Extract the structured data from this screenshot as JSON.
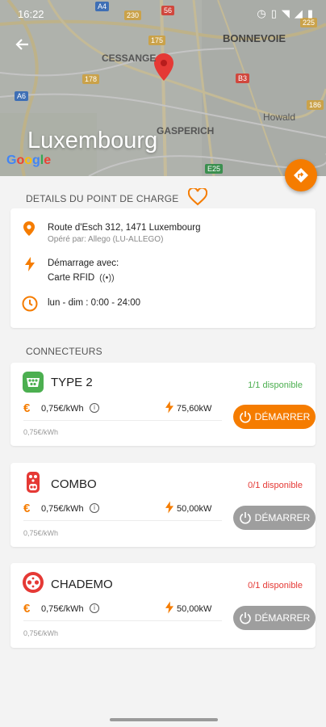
{
  "status_bar": {
    "time": "16:22"
  },
  "map": {
    "title": "Luxembourg",
    "google_logo": "Google",
    "labels": {
      "cessange": "CESSANGE",
      "bonnevoie": "BONNEVOIE",
      "gasperich": "GASPERICH",
      "howald": "Howald"
    },
    "shields": [
      "A4",
      "230",
      "56",
      "175",
      "178",
      "B3",
      "A6",
      "E25",
      "225",
      "186"
    ]
  },
  "details": {
    "section_title": "DETAILS DU POINT DE CHARGE",
    "address": "Route d'Esch 312, 1471 Luxembourg",
    "operator": "Opéré par: Allego (LU-ALLEGO)",
    "start_label": "Démarrage avec:",
    "start_method": "Carte RFID",
    "hours": "lun - dim : 0:00 - 24:00"
  },
  "connectors": {
    "section_title": "CONNECTEURS",
    "items": [
      {
        "name": "TYPE 2",
        "availability": "1/1 disponible",
        "price": "0,75€/kWh",
        "power": "75,60kW",
        "sub_price": "0,75€/kWh",
        "button": "DÉMARRER"
      },
      {
        "name": "COMBO",
        "availability": "0/1 disponible",
        "price": "0,75€/kWh",
        "power": "50,00kW",
        "sub_price": "0,75€/kWh",
        "button": "DÉMARRER"
      },
      {
        "name": "CHADEMO",
        "availability": "0/1 disponible",
        "price": "0,75€/kWh",
        "power": "50,00kW",
        "sub_price": "0,75€/kWh",
        "button": "DÉMARRER"
      }
    ]
  },
  "colors": {
    "accent": "#f57c00",
    "available": "#4caf50",
    "unavailable": "#e53935",
    "disabled": "#9e9e9e"
  },
  "icons": [
    "arrow-left-icon",
    "directions-icon",
    "heart-outline-icon",
    "location-pin-icon",
    "bolt-icon",
    "clock-icon",
    "nfc-icon",
    "euro-icon",
    "info-icon",
    "power-icon"
  ]
}
